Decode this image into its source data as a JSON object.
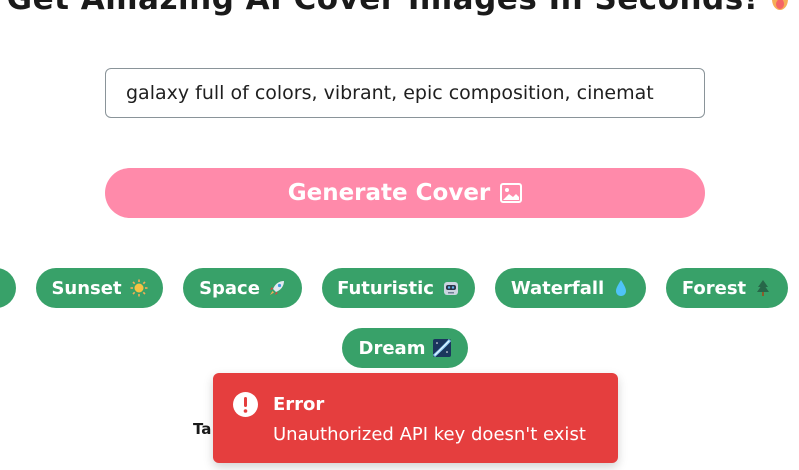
{
  "header": {
    "title": "Get Amazing AI Cover Images In Seconds!",
    "title_icon": "fire-icon"
  },
  "prompt": {
    "value": "galaxy full of colors, vibrant, epic composition, cinemat"
  },
  "generate": {
    "label": "Generate Cover",
    "icon": "picture-icon",
    "color": "#ff8aaa"
  },
  "suggestions": {
    "color": "#38a169",
    "items": [
      {
        "label": "",
        "icon": "cut-off-chip"
      },
      {
        "label": "Sunset",
        "icon": "sun-icon"
      },
      {
        "label": "Space",
        "icon": "rocket-icon"
      },
      {
        "label": "Futuristic",
        "icon": "robot-icon"
      },
      {
        "label": "Waterfall",
        "icon": "droplet-icon"
      },
      {
        "label": "Forest",
        "icon": "tree-icon"
      },
      {
        "label": "Dream",
        "icon": "milky-way-icon"
      }
    ]
  },
  "obscured_text": "Ta",
  "toast": {
    "title": "Error",
    "message": "Unauthorized API key doesn't exist",
    "color": "#e53e3e",
    "icon": "alert-circle-icon"
  }
}
